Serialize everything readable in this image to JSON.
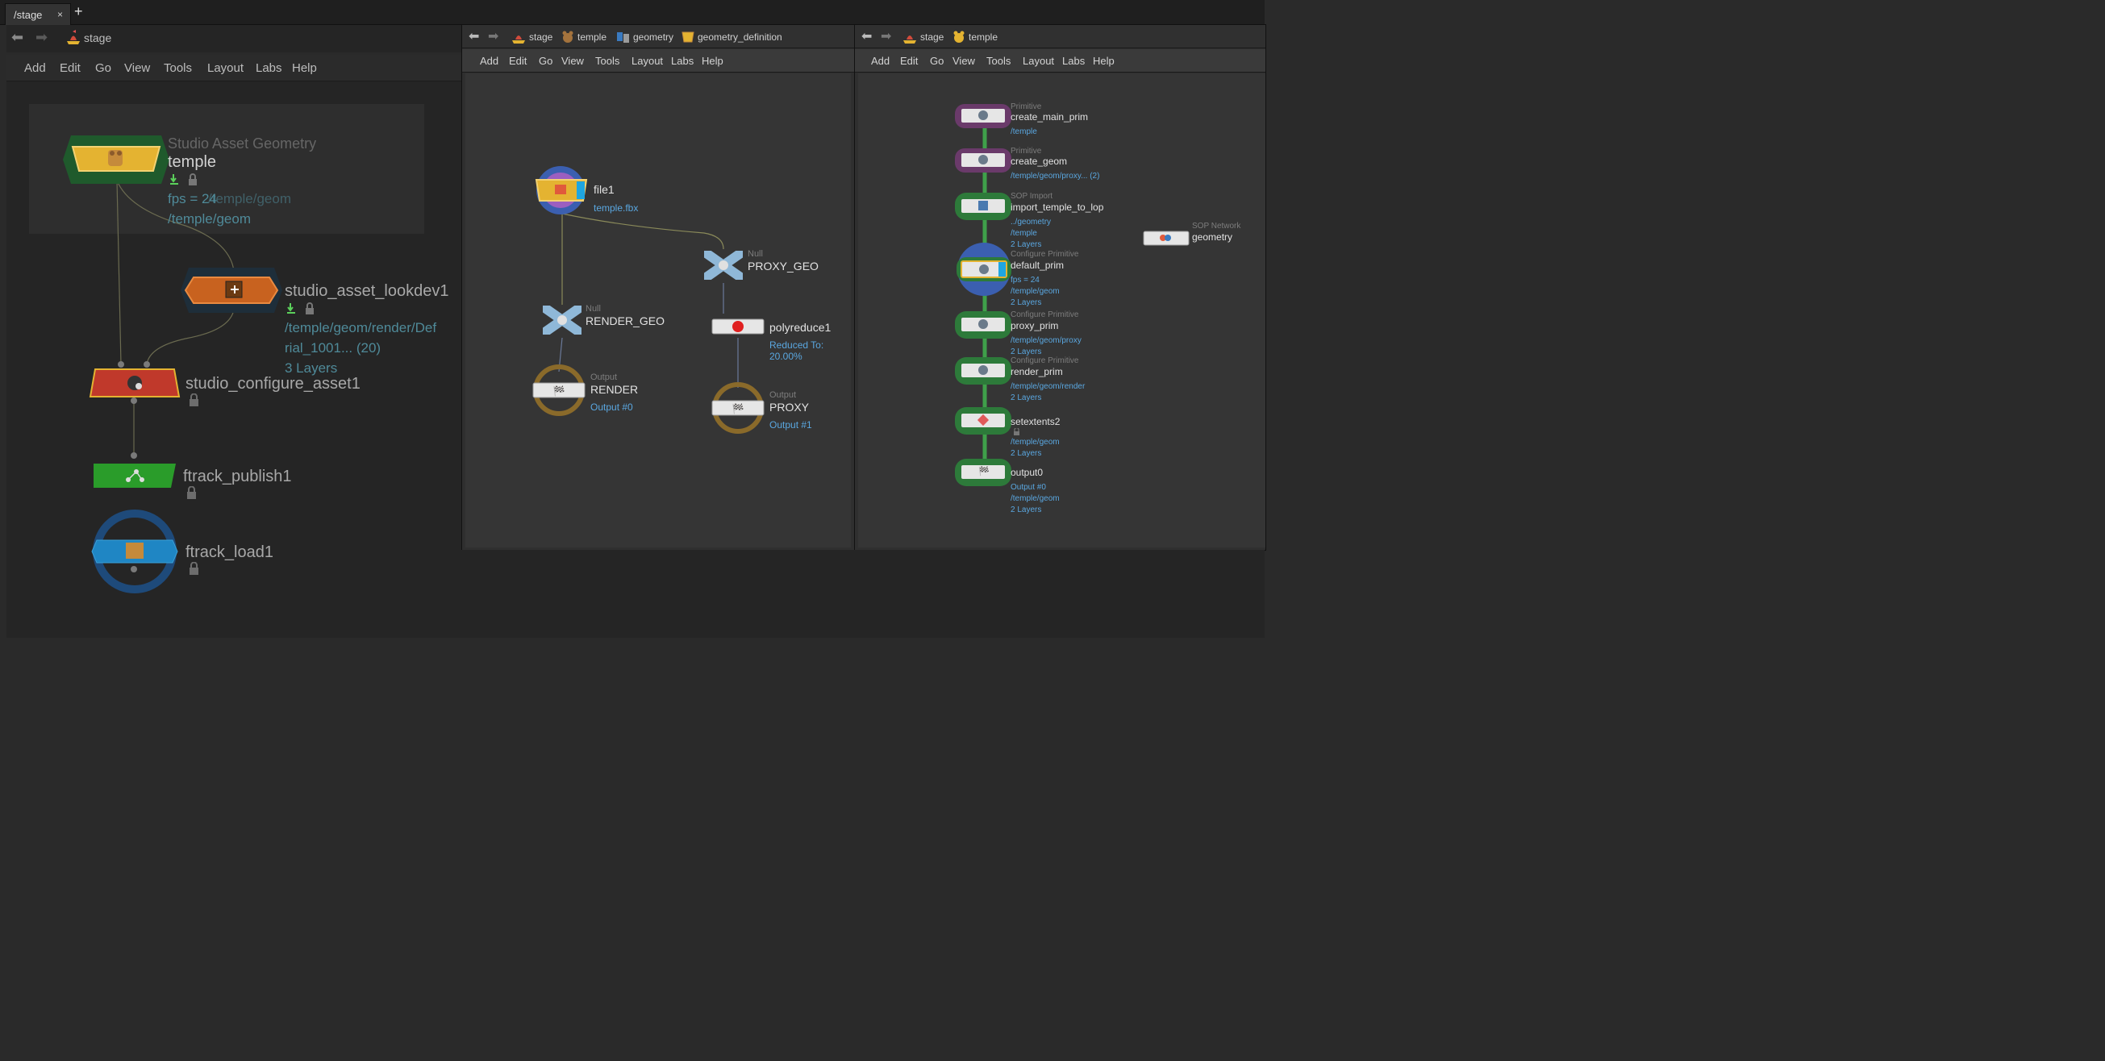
{
  "tabs": {
    "active": "/stage",
    "close": "×",
    "add": "+"
  },
  "left": {
    "path_label": "stage",
    "menu": [
      "Add",
      "Edit",
      "Go",
      "View",
      "Tools",
      "Layout",
      "Labs",
      "Help"
    ],
    "box_title": "Studio Asset Geometry",
    "nodes": {
      "temple": {
        "name": "temple",
        "param_a": "fps = 24",
        "param_b": "/temple/geom",
        "param_c": "/temple/geom"
      },
      "lookdev": {
        "name": "studio_asset_lookdev1",
        "line1": "/temple/geom/render/Def",
        "line2": "rial_1001... (20)",
        "line3": "3 Layers"
      },
      "configure": {
        "name": "studio_configure_asset1"
      },
      "publish": {
        "name": "ftrack_publish1"
      },
      "load": {
        "name": "ftrack_load1"
      }
    }
  },
  "middle": {
    "breadcrumbs": [
      "stage",
      "temple",
      "geometry",
      "geometry_definition"
    ],
    "menu": [
      "Add",
      "Edit",
      "Go",
      "View",
      "Tools",
      "Layout",
      "Labs",
      "Help"
    ],
    "nodes": {
      "file1": {
        "name": "file1",
        "info": "temple.fbx"
      },
      "proxy_geo": {
        "type": "Null",
        "name": "PROXY_GEO"
      },
      "render_geo": {
        "type": "Null",
        "name": "RENDER_GEO"
      },
      "polyreduce": {
        "name": "polyreduce1",
        "info": "Reduced To: 20.00%"
      },
      "render": {
        "type": "Output",
        "name": "RENDER",
        "info": "Output #0"
      },
      "proxy": {
        "type": "Output",
        "name": "PROXY",
        "info": "Output #1"
      }
    }
  },
  "right": {
    "breadcrumbs": [
      "stage",
      "temple"
    ],
    "menu": [
      "Add",
      "Edit",
      "Go",
      "View",
      "Tools",
      "Layout",
      "Labs",
      "Help"
    ],
    "nodes": [
      {
        "type": "Primitive",
        "name": "create_main_prim",
        "info": [
          "/temple"
        ]
      },
      {
        "type": "Primitive",
        "name": "create_geom",
        "info": [
          "/temple/geom/proxy... (2)"
        ]
      },
      {
        "type": "SOP Import",
        "name": "import_temple_to_lop",
        "info": [
          "../geometry",
          "/temple",
          "2 Layers"
        ]
      },
      {
        "type": "Configure Primitive",
        "name": "default_prim",
        "info": [
          "fps = 24",
          "/temple/geom",
          "2 Layers"
        ]
      },
      {
        "type": "Configure Primitive",
        "name": "proxy_prim",
        "info": [
          "/temple/geom/proxy",
          "2 Layers"
        ]
      },
      {
        "type": "Configure Primitive",
        "name": "render_prim",
        "info": [
          "/temple/geom/render",
          "2 Layers"
        ]
      },
      {
        "type": "",
        "name": "setextents2",
        "info": [
          "/temple/geom",
          "2 Layers"
        ]
      },
      {
        "type": "",
        "name": "output0",
        "info": [
          "Output #0",
          "/temple/geom",
          "2 Layers"
        ]
      }
    ],
    "sop_network": {
      "type": "SOP Network",
      "name": "geometry"
    }
  },
  "colors": {
    "accent_blue": "#5aa7e0",
    "node_green": "#2d7a3a",
    "node_purple": "#7a3a7a",
    "node_yellow": "#e4b331",
    "node_red": "#c0392b",
    "node_orange": "#d2691e"
  }
}
